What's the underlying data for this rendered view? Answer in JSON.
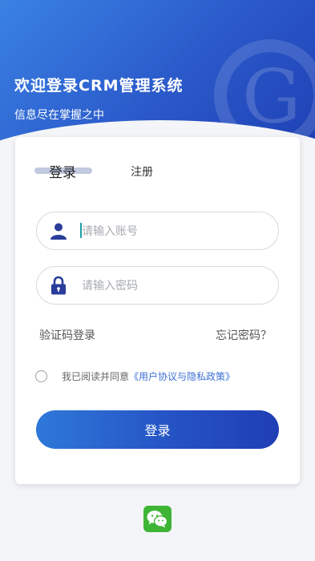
{
  "hero": {
    "title": "欢迎登录CRM管理系统",
    "subtitle": "信息尽在掌握之中"
  },
  "tabs": {
    "login": "登录",
    "register": "注册"
  },
  "account": {
    "placeholder": "请输入账号"
  },
  "password": {
    "placeholder": "请输入密码"
  },
  "links": {
    "code_login": "验证码登录",
    "forgot": "忘记密码？"
  },
  "agreement": {
    "prefix": "我已阅读并同意",
    "link": "《用户协议与隐私政策》",
    "checked": false
  },
  "submit_label": "登录",
  "colors": {
    "primary": "#2a58c9",
    "gradient_start": "#3a82e3",
    "gradient_end": "#1e3fb3",
    "link": "#3b6fd6",
    "wechat": "#3fb536",
    "icon": "#2a3d9a"
  },
  "icons": {
    "account": "user-icon",
    "password": "lock-icon",
    "social": "wechat-icon",
    "logo": "logo-watermark"
  }
}
